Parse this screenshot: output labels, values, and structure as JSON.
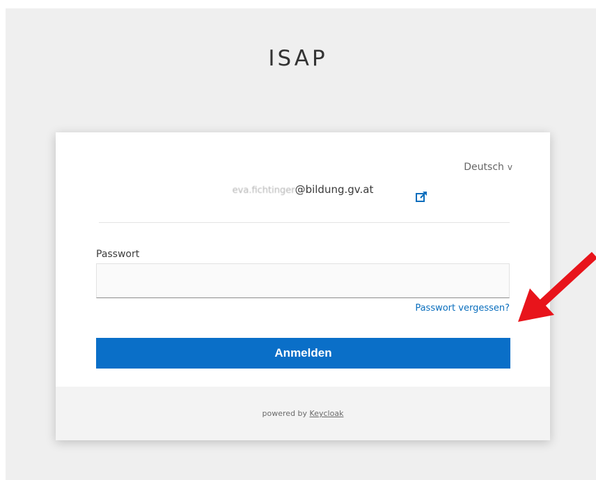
{
  "app": {
    "title": "ISAP"
  },
  "login": {
    "language": "Deutsch",
    "username_blurred": "eva.fichtinger",
    "username_domain": "@bildung.gv.at",
    "password_label": "Passwort",
    "password_value": "",
    "forgot_password": "Passwort vergessen?",
    "submit_label": "Anmelden"
  },
  "footer": {
    "powered_by": "powered by",
    "link": "Keycloak"
  },
  "colors": {
    "accent": "#0a6fc8",
    "link": "#0a6ebd",
    "annotation_arrow": "#e8141b",
    "background": "#efefef"
  },
  "icons": {
    "language_caret": "chevron-down-icon",
    "reset_login": "external-link-icon"
  }
}
